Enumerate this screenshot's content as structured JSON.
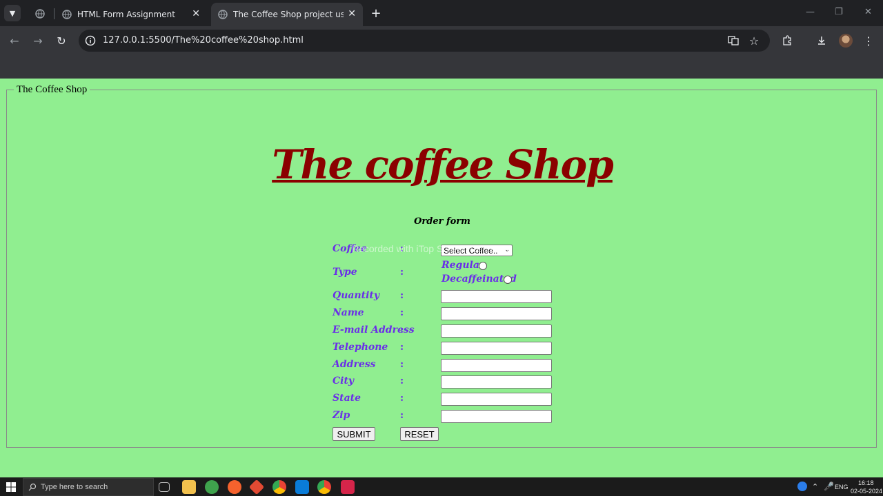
{
  "browser": {
    "tabs": [
      {
        "title": "HTML Form Assignment",
        "active": false
      },
      {
        "title": "The Coffee Shop project using",
        "active": true
      }
    ],
    "url": "127.0.0.1:5500/The%20coffee%20shop.html"
  },
  "page": {
    "legend": "The Coffee Shop",
    "heading": "The coffee Shop",
    "subheading": "Order form",
    "watermark": "Recorded with iTop Screen Recorder",
    "colors": {
      "background": "#90ee90",
      "heading": "#8b0000",
      "label": "#6a2ee8"
    },
    "form": {
      "coffee_label": "Coffee",
      "coffee_selected": "Select Coffee..",
      "type_label": "Type",
      "type_options": [
        "Regular",
        "Decaffeinated"
      ],
      "quantity_label": "Quantity",
      "name_label": "Name",
      "email_label": "E-mail Address",
      "telephone_label": "Telephone",
      "address_label": "Address",
      "city_label": "City",
      "state_label": "State",
      "zip_label": "Zip",
      "colon": ":",
      "submit_label": "SUBMIT",
      "reset_label": "RESET"
    }
  },
  "taskbar": {
    "search_placeholder": "Type here to search",
    "lang": "ENG",
    "time": "16:18",
    "date": "02-05-2024"
  }
}
